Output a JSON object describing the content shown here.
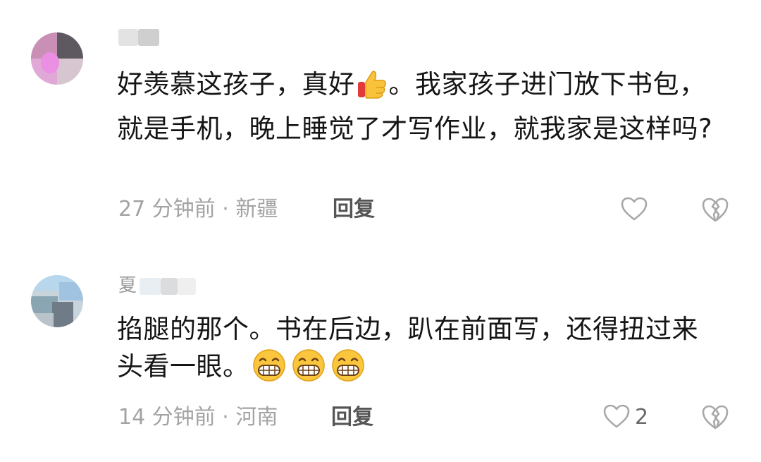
{
  "comments": [
    {
      "content_parts": [
        "好羡慕这孩子，真好",
        "。我家孩子进门放下书包，就是手机，晚上睡觉了才写作业，就我家是这样吗?"
      ],
      "emoji": "thumbs-up",
      "time_location": "27 分钟前 · 新疆",
      "reply_label": "回复",
      "like_count": ""
    },
    {
      "username_visible": "夏",
      "content": "掐腿的那个。书在后边，趴在前面写，还得扭过来头看一眼。",
      "emoji": "grinning-face",
      "time_location": "14 分钟前 · 河南",
      "reply_label": "回复",
      "like_count": "2"
    }
  ]
}
